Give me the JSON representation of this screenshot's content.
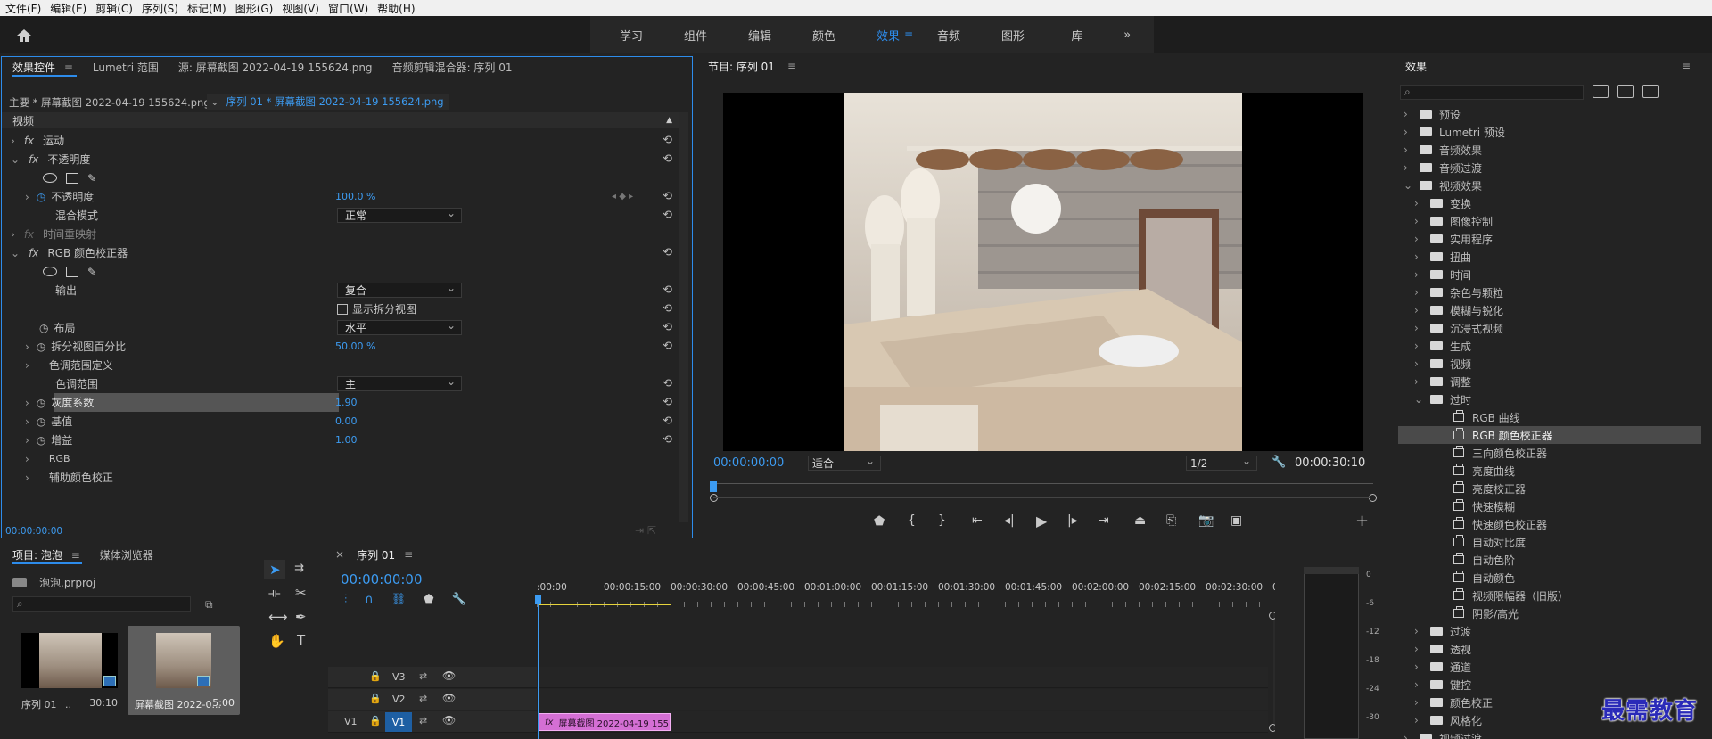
{
  "menu": [
    "文件(F)",
    "编辑(E)",
    "剪辑(C)",
    "序列(S)",
    "标记(M)",
    "图形(G)",
    "视图(V)",
    "窗口(W)",
    "帮助(H)"
  ],
  "workspaces": [
    "学习",
    "组件",
    "编辑",
    "颜色",
    "效果",
    "音频",
    "图形",
    "库"
  ],
  "workspace_active": "效果",
  "workspace_more": "»",
  "ec": {
    "tabs": [
      "效果控件",
      "Lumetri 范围",
      "源: 屏幕截图 2022-04-19  155624.png",
      "音频剪辑混合器: 序列 01"
    ],
    "tab_menu": "≡",
    "master": "主要 * 屏幕截图 2022-04-19  155624.png",
    "sequence_clip": "序列 01 * 屏幕截图 2022-04-19  155624.png",
    "video_header": "视频",
    "rows": {
      "motion": "运动",
      "opacity": "不透明度",
      "opacity_prop": "不透明度",
      "opacity_val": "100.0 %",
      "blend_mode": "混合模式",
      "blend_val": "正常",
      "time_remap": "时间重映射",
      "rgb_cc": "RGB 颜色校正器",
      "output": "输出",
      "output_val": "复合",
      "show_split": "显示拆分视图",
      "layout": "布局",
      "layout_val": "水平",
      "split_pct": "拆分视图百分比",
      "split_val": "50.00 %",
      "tonal_def": "色调范围定义",
      "tonal_range": "色调范围",
      "tonal_val": "主",
      "gamma": "灰度系数",
      "gamma_val": "1.90",
      "pedestal": "基值",
      "pedestal_val": "0.00",
      "gain": "增益",
      "gain_val": "1.00",
      "rgb": "RGB",
      "secondary": "辅助颜色校正"
    },
    "timecode": "00:00:00:00"
  },
  "program": {
    "title": "节目: 序列 01",
    "timecode": "00:00:00:00",
    "fit": "适合",
    "res": "1/2",
    "duration": "00:00:30:10"
  },
  "effects": {
    "title": "效果",
    "search_placeholder": "",
    "tree": [
      {
        "label": "预设",
        "level": 0,
        "type": "bin",
        "open": false
      },
      {
        "label": "Lumetri 预设",
        "level": 0,
        "type": "bin",
        "open": false
      },
      {
        "label": "音频效果",
        "level": 0,
        "type": "folder",
        "open": false
      },
      {
        "label": "音频过渡",
        "level": 0,
        "type": "folder",
        "open": false
      },
      {
        "label": "视频效果",
        "level": 0,
        "type": "folder",
        "open": true
      },
      {
        "label": "变换",
        "level": 1,
        "type": "folder",
        "open": false
      },
      {
        "label": "图像控制",
        "level": 1,
        "type": "folder",
        "open": false
      },
      {
        "label": "实用程序",
        "level": 1,
        "type": "folder",
        "open": false
      },
      {
        "label": "扭曲",
        "level": 1,
        "type": "folder",
        "open": false
      },
      {
        "label": "时间",
        "level": 1,
        "type": "folder",
        "open": false
      },
      {
        "label": "杂色与颗粒",
        "level": 1,
        "type": "folder",
        "open": false
      },
      {
        "label": "模糊与锐化",
        "level": 1,
        "type": "folder",
        "open": false
      },
      {
        "label": "沉浸式视频",
        "level": 1,
        "type": "folder",
        "open": false
      },
      {
        "label": "生成",
        "level": 1,
        "type": "folder",
        "open": false
      },
      {
        "label": "视频",
        "level": 1,
        "type": "folder",
        "open": false
      },
      {
        "label": "调整",
        "level": 1,
        "type": "folder",
        "open": false
      },
      {
        "label": "过时",
        "level": 1,
        "type": "folder",
        "open": true
      },
      {
        "label": "RGB 曲线",
        "level": 2,
        "type": "effect"
      },
      {
        "label": "RGB 颜色校正器",
        "level": 2,
        "type": "effect",
        "selected": true
      },
      {
        "label": "三向颜色校正器",
        "level": 2,
        "type": "effect"
      },
      {
        "label": "亮度曲线",
        "level": 2,
        "type": "effect"
      },
      {
        "label": "亮度校正器",
        "level": 2,
        "type": "effect"
      },
      {
        "label": "快速模糊",
        "level": 2,
        "type": "effect"
      },
      {
        "label": "快速颜色校正器",
        "level": 2,
        "type": "effect"
      },
      {
        "label": "自动对比度",
        "level": 2,
        "type": "effect"
      },
      {
        "label": "自动色阶",
        "level": 2,
        "type": "effect"
      },
      {
        "label": "自动颜色",
        "level": 2,
        "type": "effect"
      },
      {
        "label": "视频限幅器（旧版）",
        "level": 2,
        "type": "effect"
      },
      {
        "label": "阴影/高光",
        "level": 2,
        "type": "effect"
      },
      {
        "label": "过渡",
        "level": 1,
        "type": "folder",
        "open": false
      },
      {
        "label": "透视",
        "level": 1,
        "type": "folder",
        "open": false
      },
      {
        "label": "通道",
        "level": 1,
        "type": "folder",
        "open": false
      },
      {
        "label": "键控",
        "level": 1,
        "type": "folder",
        "open": false
      },
      {
        "label": "颜色校正",
        "level": 1,
        "type": "folder",
        "open": false
      },
      {
        "label": "风格化",
        "level": 1,
        "type": "folder",
        "open": false
      },
      {
        "label": "视频过渡",
        "level": 0,
        "type": "folder",
        "open": false
      }
    ]
  },
  "project": {
    "tab": "项目: 泡泡",
    "tab2": "媒体浏览器",
    "file": "泡泡.prproj",
    "items": [
      {
        "name": "序列 01",
        "sep": "..",
        "dur": "30:10"
      },
      {
        "name": "屏幕截图 2022-0...",
        "sep": "",
        "dur": "5:00"
      }
    ]
  },
  "timeline": {
    "close": "×",
    "title": "序列 01",
    "timecode": "00:00:00:00",
    "ruler": [
      ":00:00",
      "00:00:15:00",
      "00:00:30:00",
      "00:00:45:00",
      "00:01:00:00",
      "00:01:15:00",
      "00:01:30:00",
      "00:01:45:00",
      "00:02:00:00",
      "00:02:15:00",
      "00:02:30:00",
      "00:0"
    ],
    "tracks": [
      "V3",
      "V2",
      "V1"
    ],
    "source_patch": "V1",
    "clip": "屏幕截图 2022-04-19 155",
    "clip_fx": "fx"
  },
  "meter": [
    "0",
    "-6",
    "-12",
    "-18",
    "-24",
    "-30"
  ],
  "watermark": "最需教育",
  "colors": {
    "accent": "#2d8ceb",
    "clip": "#d46fd4",
    "playhead": "#3c9bf1"
  }
}
